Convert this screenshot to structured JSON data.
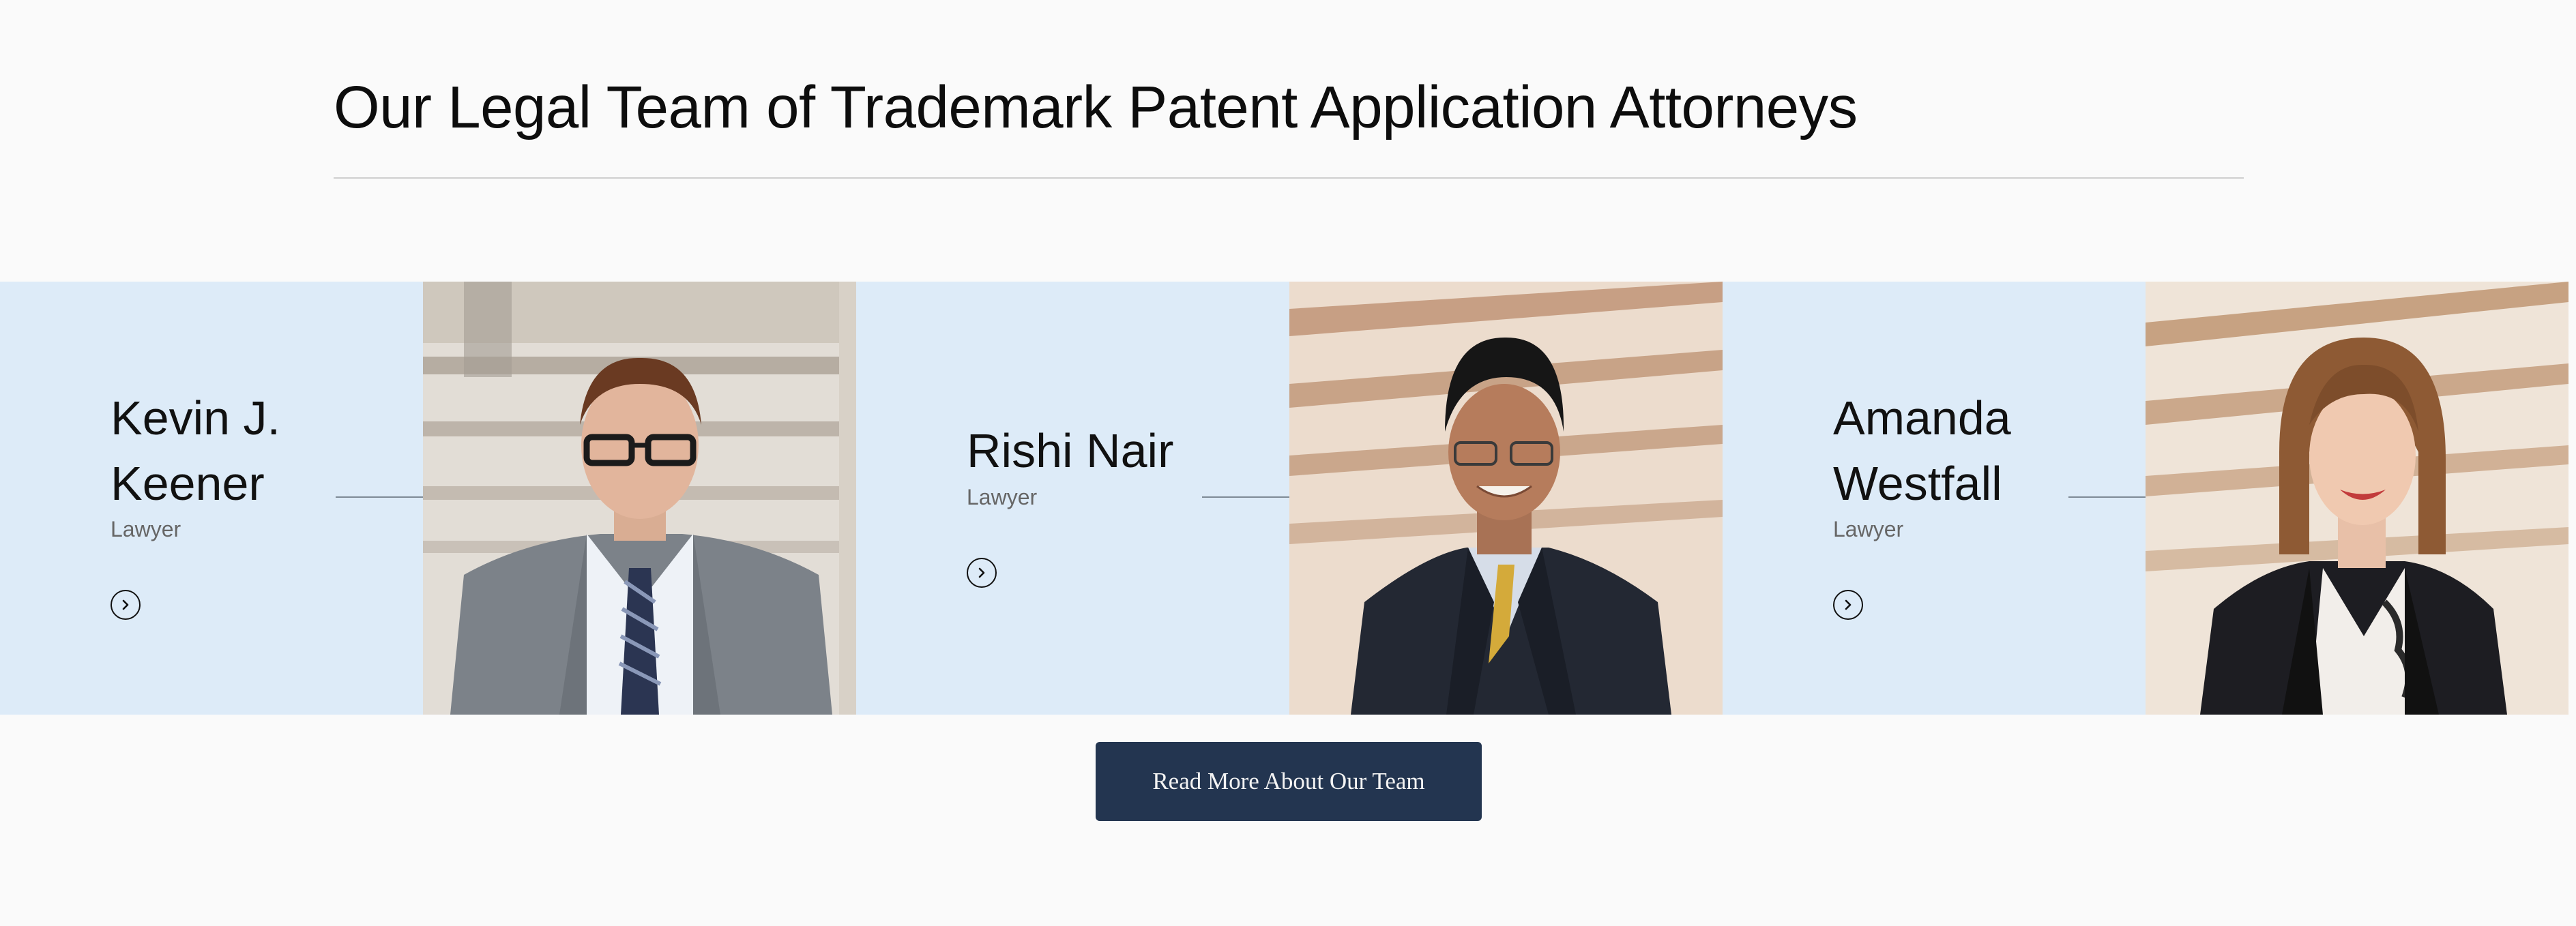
{
  "section": {
    "title": "Our Legal Team of Trademark Patent Application Attorneys"
  },
  "team": [
    {
      "name_line1": "Kevin J.",
      "name_line2": "Keener",
      "role": "Lawyer"
    },
    {
      "name_line1": "Rishi Nair",
      "name_line2": "",
      "role": "Lawyer"
    },
    {
      "name_line1": "Amanda",
      "name_line2": "Westfall",
      "role": "Lawyer"
    }
  ],
  "cta": {
    "label": "Read More About Our Team"
  },
  "colors": {
    "panel_bg": "#ddebf8",
    "cta_bg": "#233550",
    "page_bg": "#fafafa"
  },
  "icons": {
    "member_link": "chevron-right-circle-icon"
  }
}
